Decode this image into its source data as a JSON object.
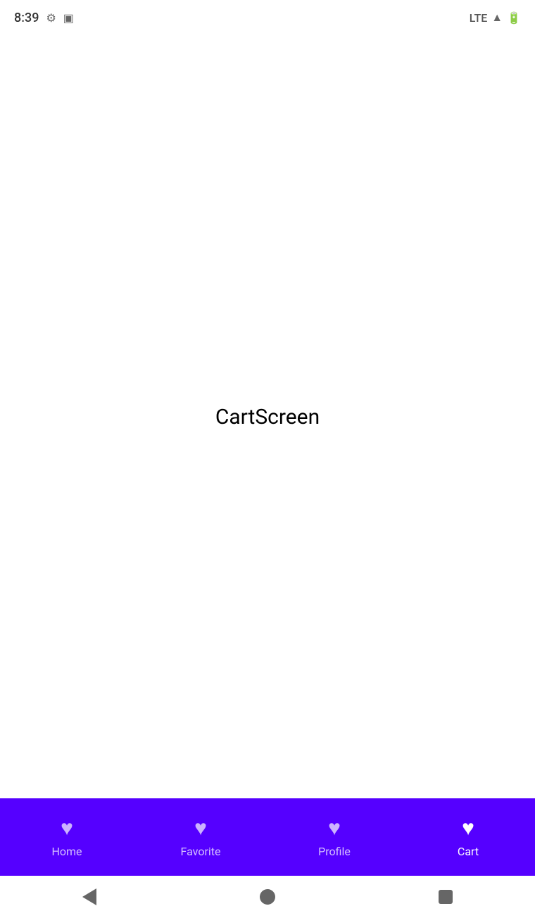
{
  "statusBar": {
    "time": "8:39",
    "icons": {
      "settings": "⚙",
      "sim": "▣"
    },
    "rightIcons": {
      "lte": "LTE",
      "signal": "▲",
      "battery": "🔋"
    }
  },
  "mainContent": {
    "screenLabel": "CartScreen"
  },
  "bottomNav": {
    "items": [
      {
        "id": "home",
        "label": "Home",
        "icon": "♥",
        "active": false
      },
      {
        "id": "favorite",
        "label": "Favorite",
        "icon": "♥",
        "active": false
      },
      {
        "id": "profile",
        "label": "Profile",
        "icon": "♥",
        "active": false
      },
      {
        "id": "cart",
        "label": "Cart",
        "icon": "♥",
        "active": true
      }
    ],
    "backgroundColor": "#5500ff"
  },
  "androidNav": {
    "back": "◀",
    "home": "●",
    "recent": "■"
  }
}
